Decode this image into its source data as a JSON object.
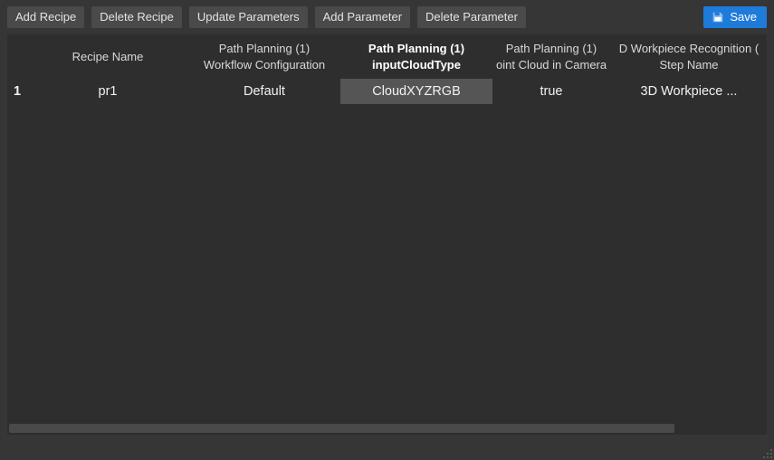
{
  "toolbar": {
    "add_recipe": "Add Recipe",
    "delete_recipe": "Delete Recipe",
    "update_parameters": "Update Parameters",
    "add_parameter": "Add Parameter",
    "delete_parameter": "Delete Parameter",
    "save": "Save"
  },
  "table": {
    "headers": [
      {
        "line1": "",
        "line2": "Recipe Name",
        "active": false
      },
      {
        "line1": "Path Planning (1)",
        "line2": "Workflow Configuration",
        "active": false
      },
      {
        "line1": "Path Planning (1)",
        "line2": "inputCloudType",
        "active": true
      },
      {
        "line1": "Path Planning (1)",
        "line2": "oint Cloud in Camera",
        "active": false
      },
      {
        "line1": "D Workpiece Recognition (",
        "line2": "Step Name",
        "active": false
      }
    ],
    "rows": [
      {
        "num": "1",
        "cells": [
          "pr1",
          "Default",
          "CloudXYZRGB",
          "true",
          "3D Workpiece ..."
        ],
        "selected_col": 2
      }
    ]
  }
}
